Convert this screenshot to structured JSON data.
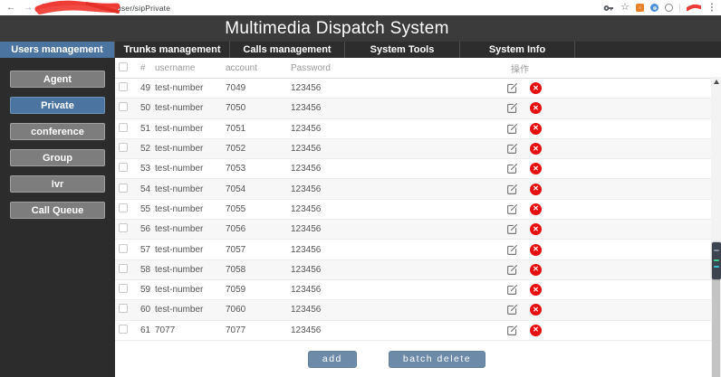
{
  "browser": {
    "back_icon": "back-arrow",
    "forward_icon": "forward-arrow",
    "reload_icon": "reload",
    "url": "00/#/user/sipPrivate",
    "right_icons": [
      "key-icon",
      "star-icon",
      "extension-orange-icon",
      "extension-blue-icon",
      "extension-ring-icon",
      "menu-dots-icon"
    ],
    "menu_dots": "⋮",
    "star": "☆",
    "back": "←",
    "forward": "→",
    "reload": "↻"
  },
  "header": {
    "title": "Multimedia Dispatch System"
  },
  "tabs": [
    {
      "label": "Users management",
      "active": true
    },
    {
      "label": "Trunks management",
      "active": false
    },
    {
      "label": "Calls management",
      "active": false
    },
    {
      "label": "System Tools",
      "active": false
    },
    {
      "label": "System Info",
      "active": false
    }
  ],
  "sidebar": {
    "items": [
      {
        "label": "Agent",
        "active": false
      },
      {
        "label": "Private",
        "active": true
      },
      {
        "label": "conference",
        "active": false
      },
      {
        "label": "Group",
        "active": false
      },
      {
        "label": "Ivr",
        "active": false
      },
      {
        "label": "Call Queue",
        "active": false
      }
    ]
  },
  "table": {
    "columns": {
      "id": "#",
      "username": "username",
      "account": "account",
      "password": "Password",
      "ops": "操作"
    },
    "rows": [
      {
        "id": "49",
        "username": "test-number",
        "account": "7049",
        "password": "123456"
      },
      {
        "id": "50",
        "username": "test-number",
        "account": "7050",
        "password": "123456"
      },
      {
        "id": "51",
        "username": "test-number",
        "account": "7051",
        "password": "123456"
      },
      {
        "id": "52",
        "username": "test-number",
        "account": "7052",
        "password": "123456"
      },
      {
        "id": "53",
        "username": "test-number",
        "account": "7053",
        "password": "123456"
      },
      {
        "id": "54",
        "username": "test-number",
        "account": "7054",
        "password": "123456"
      },
      {
        "id": "55",
        "username": "test-number",
        "account": "7055",
        "password": "123456"
      },
      {
        "id": "56",
        "username": "test-number",
        "account": "7056",
        "password": "123456"
      },
      {
        "id": "57",
        "username": "test-number",
        "account": "7057",
        "password": "123456"
      },
      {
        "id": "58",
        "username": "test-number",
        "account": "7058",
        "password": "123456"
      },
      {
        "id": "59",
        "username": "test-number",
        "account": "7059",
        "password": "123456"
      },
      {
        "id": "60",
        "username": "test-number",
        "account": "7060",
        "password": "123456"
      },
      {
        "id": "61",
        "username": "7077",
        "account": "7077",
        "password": "123456"
      }
    ]
  },
  "footer": {
    "add_label": "add",
    "batch_delete_label": "batch delete"
  },
  "colors": {
    "accent_blue": "#4b75a0",
    "button_blue": "#6d8ba8",
    "delete_red": "#e60e0e",
    "header_dark": "#3b3b3b",
    "sidebar_dark": "#2c2c2c"
  }
}
